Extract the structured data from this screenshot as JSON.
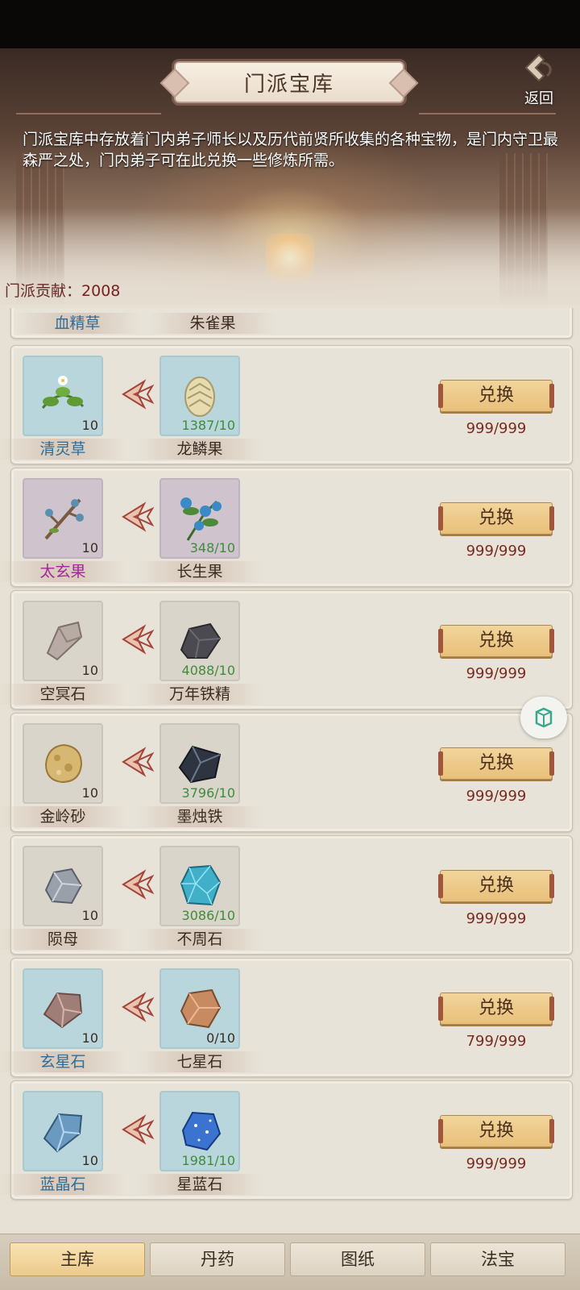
{
  "header": {
    "title": "门派宝库",
    "back_label": "返回",
    "description": "门派宝库中存放着门内弟子师长以及历代前贤所收集的各种宝物，是门内守卫最森严之处，门内弟子可在此兑换一些修炼所需。",
    "contribution_label": "门派贡献：",
    "contribution_value": "2008"
  },
  "partial_row": {
    "left_name": "血精草",
    "right_name": "朱雀果"
  },
  "rows": [
    {
      "give": {
        "name": "清灵草",
        "count": "10",
        "icon": "herb-flower-icon",
        "frame": "blue"
      },
      "get": {
        "name": "龙鳞果",
        "count": "1387/10",
        "icon": "dragon-scale-fruit-icon"
      },
      "button": "兑换",
      "stock": "999/999"
    },
    {
      "give": {
        "name": "太玄果",
        "count": "10",
        "icon": "berry-branch-icon",
        "frame": "purple"
      },
      "get": {
        "name": "长生果",
        "count": "348/10",
        "icon": "blue-berry-plant-icon"
      },
      "button": "兑换",
      "stock": "999/999"
    },
    {
      "give": {
        "name": "空冥石",
        "count": "10",
        "icon": "grey-stone-icon",
        "frame": "white"
      },
      "get": {
        "name": "万年铁精",
        "count": "4088/10",
        "icon": "dark-ore-icon"
      },
      "button": "兑换",
      "stock": "999/999"
    },
    {
      "give": {
        "name": "金岭砂",
        "count": "10",
        "icon": "gold-sand-icon",
        "frame": "white"
      },
      "get": {
        "name": "墨烛铁",
        "count": "3796/10",
        "icon": "black-iron-icon"
      },
      "button": "兑换",
      "stock": "999/999"
    },
    {
      "give": {
        "name": "陨母",
        "count": "10",
        "icon": "meteor-ore-icon",
        "frame": "white"
      },
      "get": {
        "name": "不周石",
        "count": "3086/10",
        "icon": "cyan-crystal-icon"
      },
      "button": "兑换",
      "stock": "999/999"
    },
    {
      "give": {
        "name": "玄星石",
        "count": "10",
        "icon": "rose-stone-icon",
        "frame": "blue"
      },
      "get": {
        "name": "七星石",
        "count": "0/10",
        "icon": "copper-stone-icon"
      },
      "button": "兑换",
      "stock": "799/999"
    },
    {
      "give": {
        "name": "蓝晶石",
        "count": "10",
        "icon": "blue-crystal-icon",
        "frame": "blue"
      },
      "get": {
        "name": "星蓝石",
        "count": "1981/10",
        "icon": "star-blue-stone-icon"
      },
      "button": "兑换",
      "stock": "999/999"
    }
  ],
  "tabs": [
    "主库",
    "丹药",
    "图纸",
    "法宝"
  ],
  "active_tab": "主库",
  "colors": {
    "exchange_button": "#e8c07a",
    "stock_text": "#7a2a20",
    "count_green": "#3f8c3a"
  }
}
